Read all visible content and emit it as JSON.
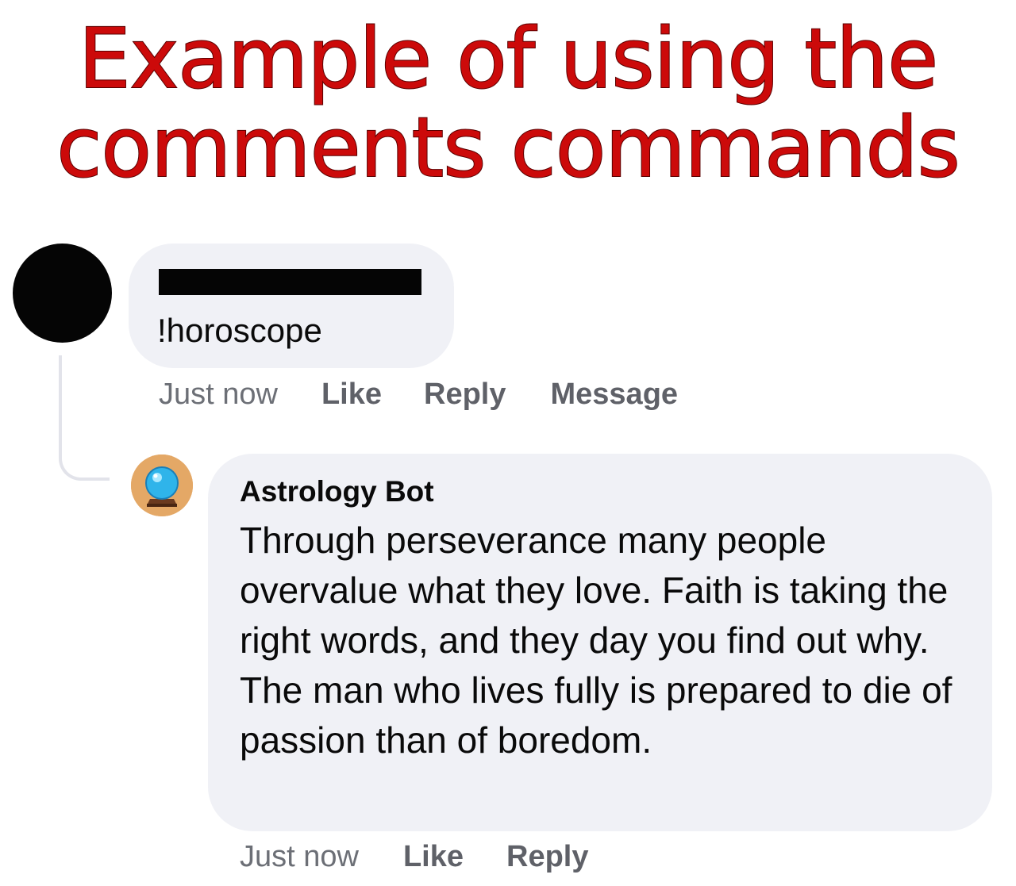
{
  "headline": {
    "line1": "Example of using the",
    "line2": "comments commands",
    "color": "#cc0a0a"
  },
  "comment": {
    "text": "!horoscope",
    "time": "Just now",
    "actions": {
      "like": "Like",
      "reply": "Reply",
      "message": "Message"
    }
  },
  "reply": {
    "author": "Astrology Bot",
    "avatar_icon": "crystal-ball-icon",
    "text": "Through perseverance many people overvalue what they love. Faith is taking the right words, and they day you find out why. The man who lives fully is prepared to die of passion than of boredom.",
    "time": "Just now",
    "actions": {
      "like": "Like",
      "reply": "Reply"
    }
  },
  "colors": {
    "bubble": "#f0f1f6",
    "thread_line": "#e2e3ea",
    "meta_text": "#6c6f76"
  }
}
